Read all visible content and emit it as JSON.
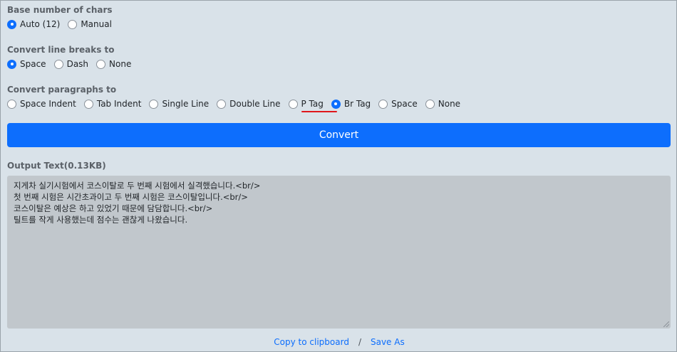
{
  "base_chars": {
    "label": "Base number of chars",
    "options": [
      {
        "label": "Auto (12)",
        "checked": true
      },
      {
        "label": "Manual",
        "checked": false
      }
    ]
  },
  "line_breaks": {
    "label": "Convert line breaks to",
    "options": [
      {
        "label": "Space",
        "checked": true
      },
      {
        "label": "Dash",
        "checked": false
      },
      {
        "label": "None",
        "checked": false
      }
    ]
  },
  "paragraphs": {
    "label": "Convert paragraphs to",
    "options": [
      {
        "label": "Space Indent",
        "checked": false
      },
      {
        "label": "Tab Indent",
        "checked": false
      },
      {
        "label": "Single Line",
        "checked": false
      },
      {
        "label": "Double Line",
        "checked": false
      },
      {
        "label": "P Tag",
        "checked": false
      },
      {
        "label": "Br Tag",
        "checked": true
      },
      {
        "label": "Space",
        "checked": false
      },
      {
        "label": "None",
        "checked": false
      }
    ]
  },
  "convert_button": "Convert",
  "output": {
    "label": "Output Text(0.13KB)",
    "lines": [
      "지게차 실기시험에서 코스이탈로 두 번째 시험에서 실격했습니다.<br/>",
      "첫 번째 시험은 시간초과이고 두 번째 시험은 코스이탈입니다.<br/>",
      "코스이탈은 예상은 하고 있었기 때문에 담담합니다.<br/>",
      "틸트를 작게 사용했는데 점수는 괜찮게 나왔습니다."
    ]
  },
  "footer": {
    "copy": "Copy to clipboard",
    "separator": "/",
    "save": "Save As"
  },
  "colors": {
    "accent": "#0d6efd",
    "highlight_underline": "#e0161b",
    "background": "#d9e2e9",
    "output_background": "#c1c7cc"
  }
}
